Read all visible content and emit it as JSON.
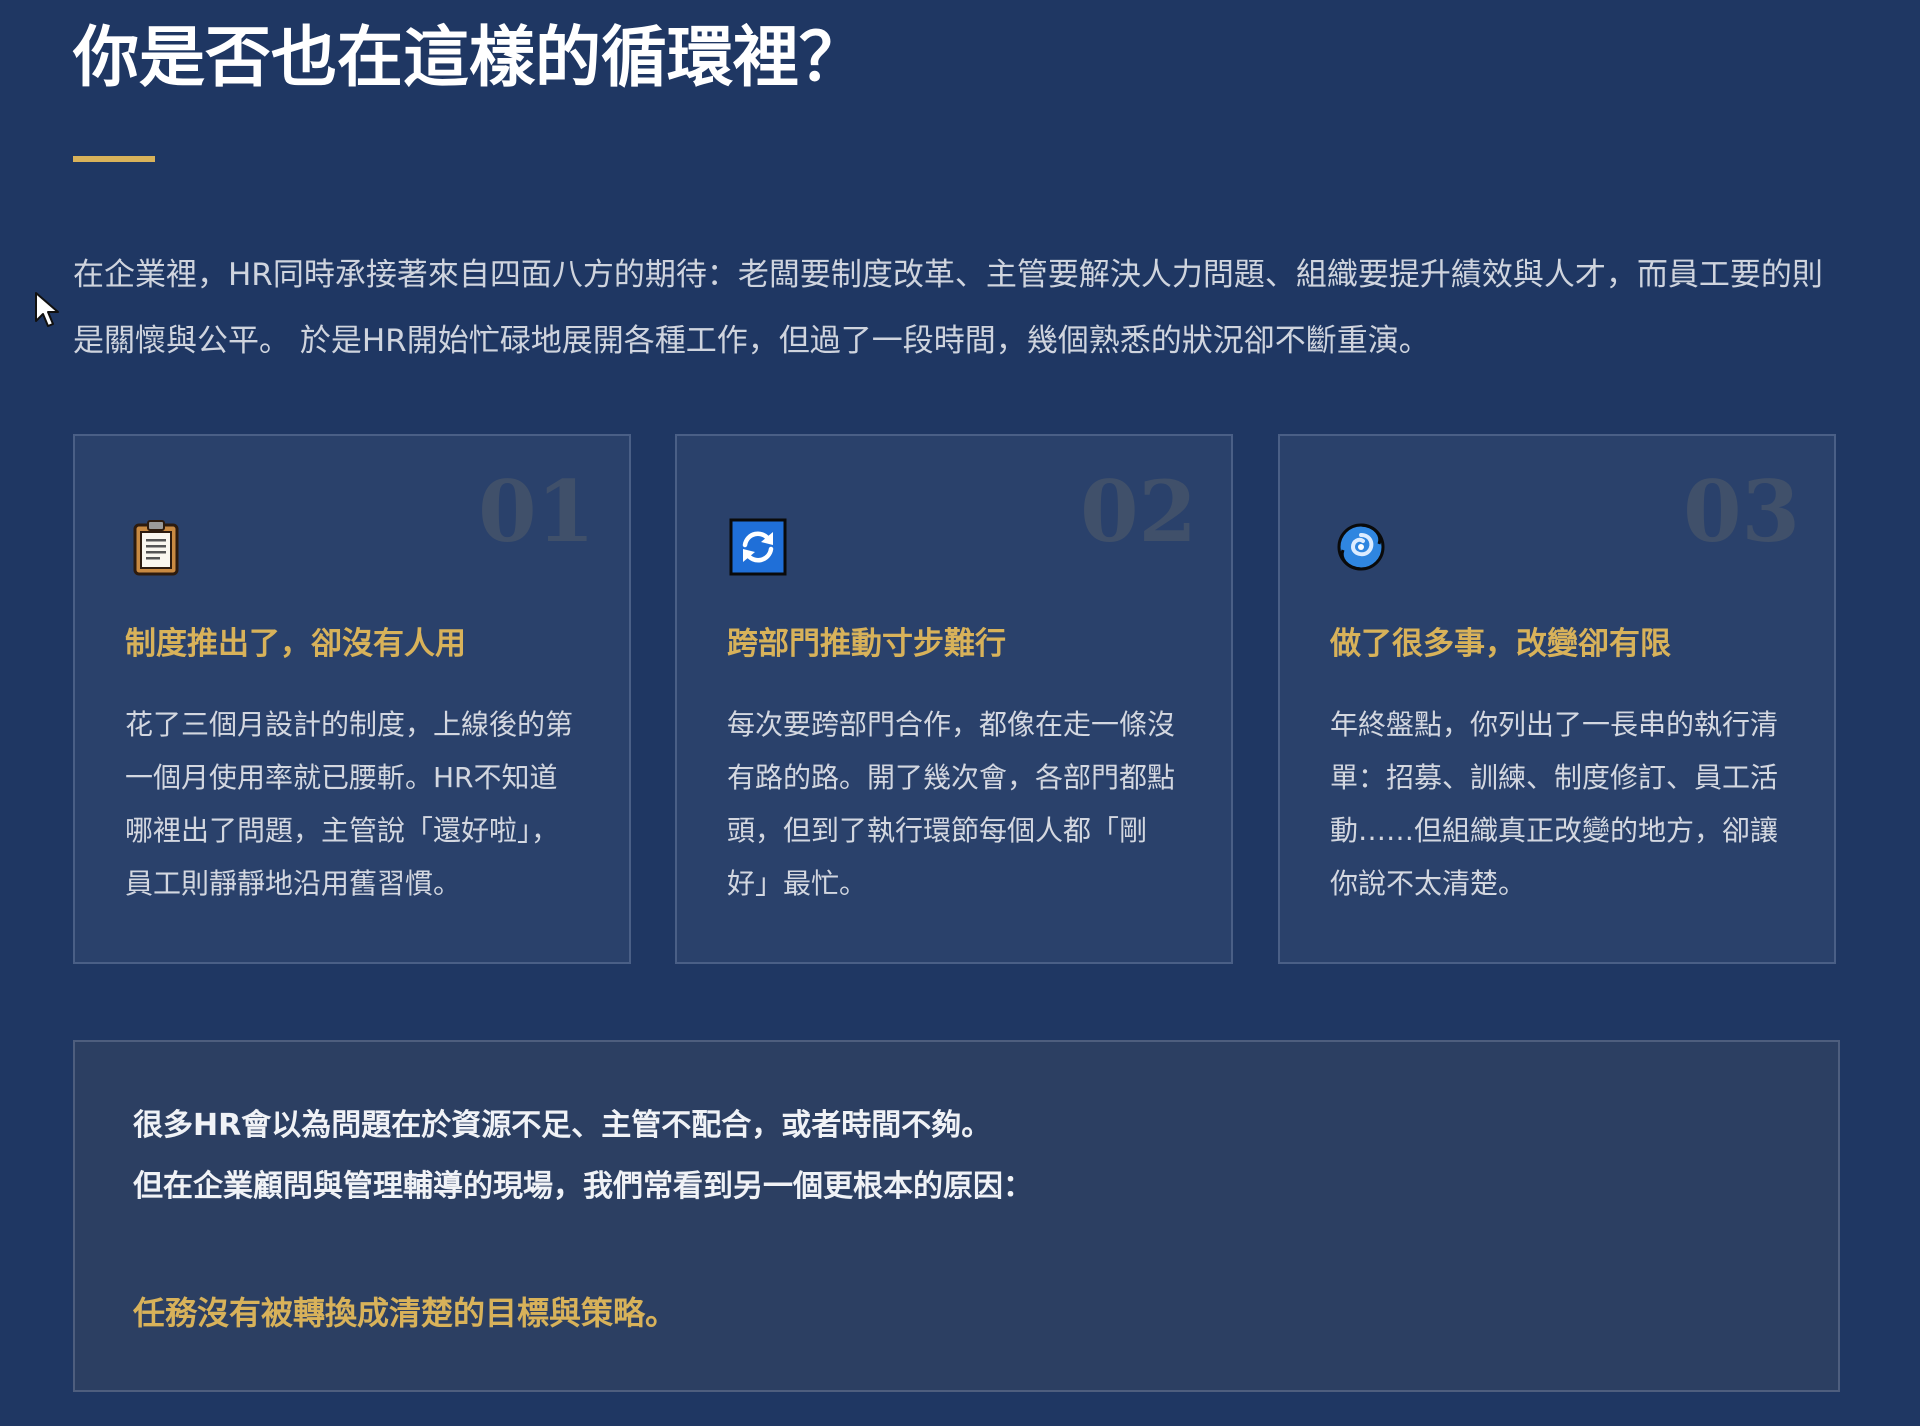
{
  "title": "你是否也在這樣的循環裡？",
  "intro": "在企業裡，HR同時承接著來自四面八方的期待：老闆要制度改革、主管要解決人力問題、組織要提升績效與人才，而員工要的則是關懷與公平。 於是HR開始忙碌地展開各種工作，但過了一段時間，幾個熟悉的狀況卻不斷重演。",
  "cards": [
    {
      "number": "01",
      "icon": "clipboard-icon",
      "heading": "制度推出了，卻沒有人用",
      "body": "花了三個月設計的制度，上線後的第一個月使用率就已腰斬。HR不知道哪裡出了問題，主管說「還好啦」，員工則靜靜地沿用舊習慣。"
    },
    {
      "number": "02",
      "icon": "refresh-arrows-icon",
      "heading": "跨部門推動寸步難行",
      "body": "每次要跨部門合作，都像在走一條沒有路的路。開了幾次會，各部門都點頭，但到了執行環節每個人都「剛好」最忙。"
    },
    {
      "number": "03",
      "icon": "cyclone-icon",
      "heading": "做了很多事，改變卻有限",
      "body": "年終盤點，你列出了一長串的執行清單：招募、訓練、制度修訂、員工活動……但組織真正改變的地方，卻讓你說不太清楚。"
    }
  ],
  "callout": {
    "line1": "很多HR會以為問題在於資源不足、主管不配合，或者時間不夠。",
    "line2": "但在企業顧問與管理輔導的現場，我們常看到另一個更根本的原因：",
    "emphasis": "任務沒有被轉換成清楚的目標與策略。"
  },
  "colors": {
    "background": "#1f3763",
    "accent_gold": "#d8b25a",
    "card_background": "#2a416b",
    "callout_background": "#2c3f62"
  }
}
